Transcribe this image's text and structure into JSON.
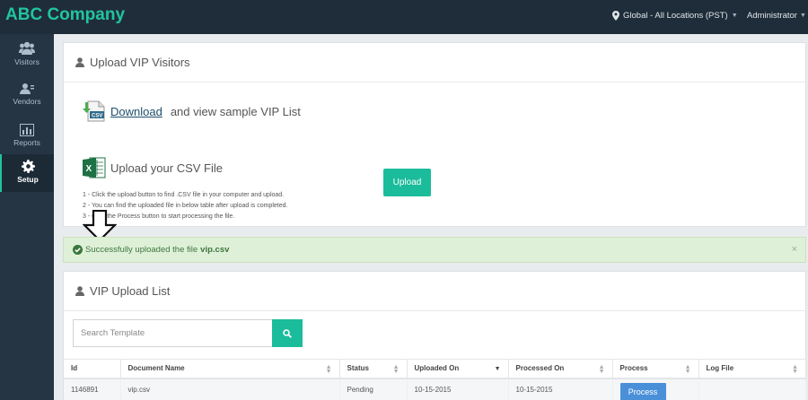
{
  "header": {
    "brand": "ABC Company",
    "location": "Global - All Locations (PST)",
    "user": "Administrator"
  },
  "sidebar": {
    "items": [
      {
        "label": "Visitors",
        "icon": "users-icon"
      },
      {
        "label": "Vendors",
        "icon": "vendors-icon"
      },
      {
        "label": "Reports",
        "icon": "bar-chart-icon"
      },
      {
        "label": "Setup",
        "icon": "gear-icon",
        "active": true
      }
    ]
  },
  "upload_panel": {
    "title": "Upload VIP Visitors",
    "download_link": "Download",
    "download_text": "and view sample VIP List",
    "upload_title": "Upload your CSV File",
    "instructions": [
      "1 - Click the upload button to find .CSV file in your computer and upload.",
      "2 - You can find the uploaded file in below table after upload is completed.",
      "3 - Click the Process button to start processing the file."
    ],
    "upload_button": "Upload"
  },
  "alert": {
    "message": "Successfully uploaded the file",
    "filename": "vip.csv",
    "close": "×"
  },
  "list_panel": {
    "title": "VIP Upload List",
    "search_placeholder": "Search Template",
    "columns": [
      "Id",
      "Document Name",
      "Status",
      "Uploaded On",
      "Processed On",
      "Process",
      "Log File"
    ],
    "rows": [
      {
        "id": "1146891",
        "document": "vip.csv",
        "status": "Pending",
        "uploaded": "10-15-2015",
        "processed": "10-15-2015",
        "process_label": "Process",
        "log": ""
      }
    ]
  },
  "colors": {
    "accent": "#1bbc9b",
    "topbar": "#1f2d3a",
    "sidebar": "#253544",
    "process_button": "#4a90d9"
  }
}
